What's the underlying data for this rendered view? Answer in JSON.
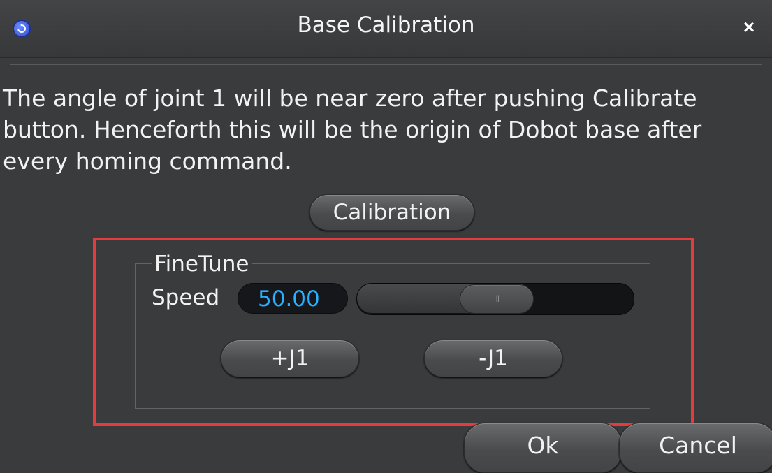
{
  "window": {
    "title": "Base Calibration",
    "close_label": "×",
    "app_icon": "dobot-logo-icon"
  },
  "description": "The angle of joint 1 will be near zero after pushing Calibrate button. Henceforth this will be the origin of Dobot base after every homing command.",
  "calibration_button": "Calibration",
  "finetune": {
    "group_title": "FineTune",
    "speed_label": "Speed",
    "speed_value": "50.00",
    "speed_fraction": 0.5,
    "plus_j1_label": "+J1",
    "minus_j1_label": "-J1"
  },
  "dialog_buttons": {
    "ok_label": "Ok",
    "cancel_label": "Cancel"
  },
  "colors": {
    "background": "#3a3b3d",
    "highlight_border": "#e43c3c",
    "speed_value_text": "#2ab0ff"
  }
}
